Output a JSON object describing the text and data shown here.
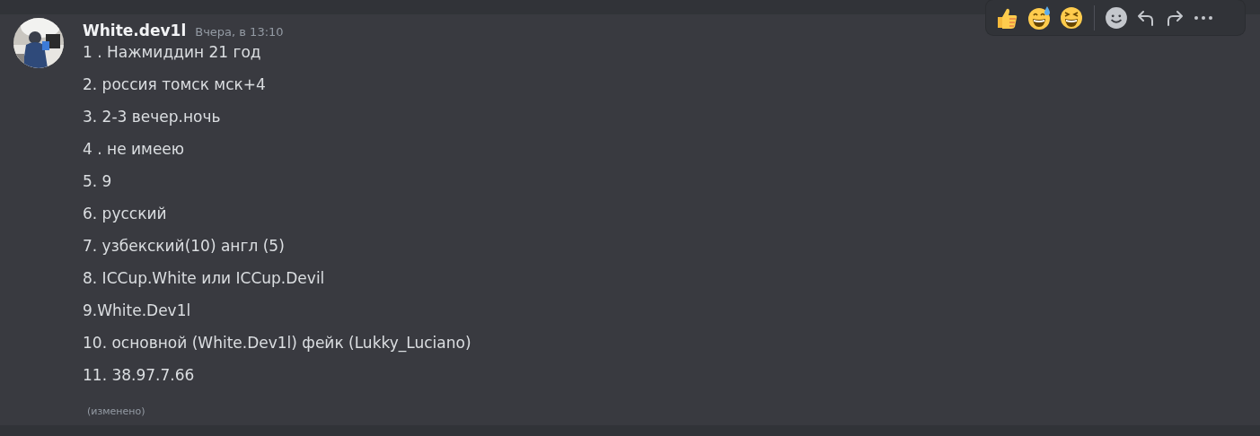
{
  "message": {
    "author": "White.dev1l",
    "timestamp": "Вчера, в 13:10",
    "lines": [
      "1 . Нажмиддин 21 год",
      "2. россия томск мск+4",
      "3. 2-3 вечер.ночь",
      "4 . не имеею",
      "5. 9",
      "6. русский",
      "7. узбекский(10) англ (5)",
      "8. ICCup.White или ICCup.Devil",
      "9.White.Dev1l",
      "10. основной (White.Dev1l) фейк (Lukky_Luciano)",
      "11. 38.97.7.66"
    ],
    "edited": "(изменено)"
  }
}
